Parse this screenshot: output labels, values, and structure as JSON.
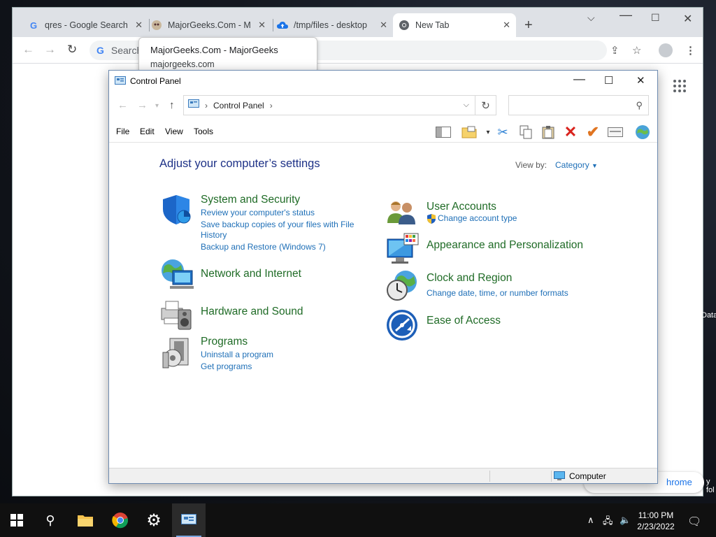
{
  "browser": {
    "tabs": [
      {
        "title": "qres - Google Search",
        "icon": "google-icon"
      },
      {
        "title": "MajorGeeks.Com - M",
        "icon": "majorgeeks-icon"
      },
      {
        "title": "/tmp/files - desktop",
        "icon": "cloud-upload-icon"
      },
      {
        "title": "New Tab",
        "icon": "chrome-icon"
      }
    ],
    "omnibox_placeholder": "Search",
    "tooltip": {
      "title": "MajorGeeks.Com - MajorGeeks",
      "url": "majorgeeks.com"
    },
    "pill_text": "hrome"
  },
  "desktop": {
    "peek_label": "Data",
    "peek_label2": "y fol"
  },
  "control_panel": {
    "window_title": "Control Panel",
    "address": "Control Panel",
    "menu": [
      "File",
      "Edit",
      "View",
      "Tools"
    ],
    "heading": "Adjust your computer’s settings",
    "view_by_label": "View by:",
    "view_by_value": "Category",
    "categories_left": [
      {
        "name": "System and Security",
        "icon": "shield-icon",
        "links": [
          "Review your computer's status",
          "Save backup copies of your files with File",
          "History",
          "Backup and Restore (Windows 7)"
        ]
      },
      {
        "name": "Network and Internet",
        "icon": "network-globe-icon",
        "links": []
      },
      {
        "name": "Hardware and Sound",
        "icon": "printer-speaker-icon",
        "links": []
      },
      {
        "name": "Programs",
        "icon": "programs-box-icon",
        "links": [
          "Uninstall a program",
          "Get programs"
        ]
      }
    ],
    "categories_right": [
      {
        "name": "User Accounts",
        "icon": "users-icon",
        "links": [
          "Change account type"
        ]
      },
      {
        "name": "Appearance and Personalization",
        "icon": "monitor-palette-icon",
        "links": []
      },
      {
        "name": "Clock and Region",
        "icon": "clock-globe-icon",
        "links": [
          "Change date, time, or number formats"
        ]
      },
      {
        "name": "Ease of Access",
        "icon": "ease-of-access-icon",
        "links": []
      }
    ],
    "status": "Computer"
  },
  "taskbar": {
    "time": "11:00 PM",
    "date": "2/23/2022"
  },
  "colors": {
    "category_green": "#1f6b26",
    "link_blue": "#1e6fb7",
    "heading_blue": "#1e3287"
  }
}
